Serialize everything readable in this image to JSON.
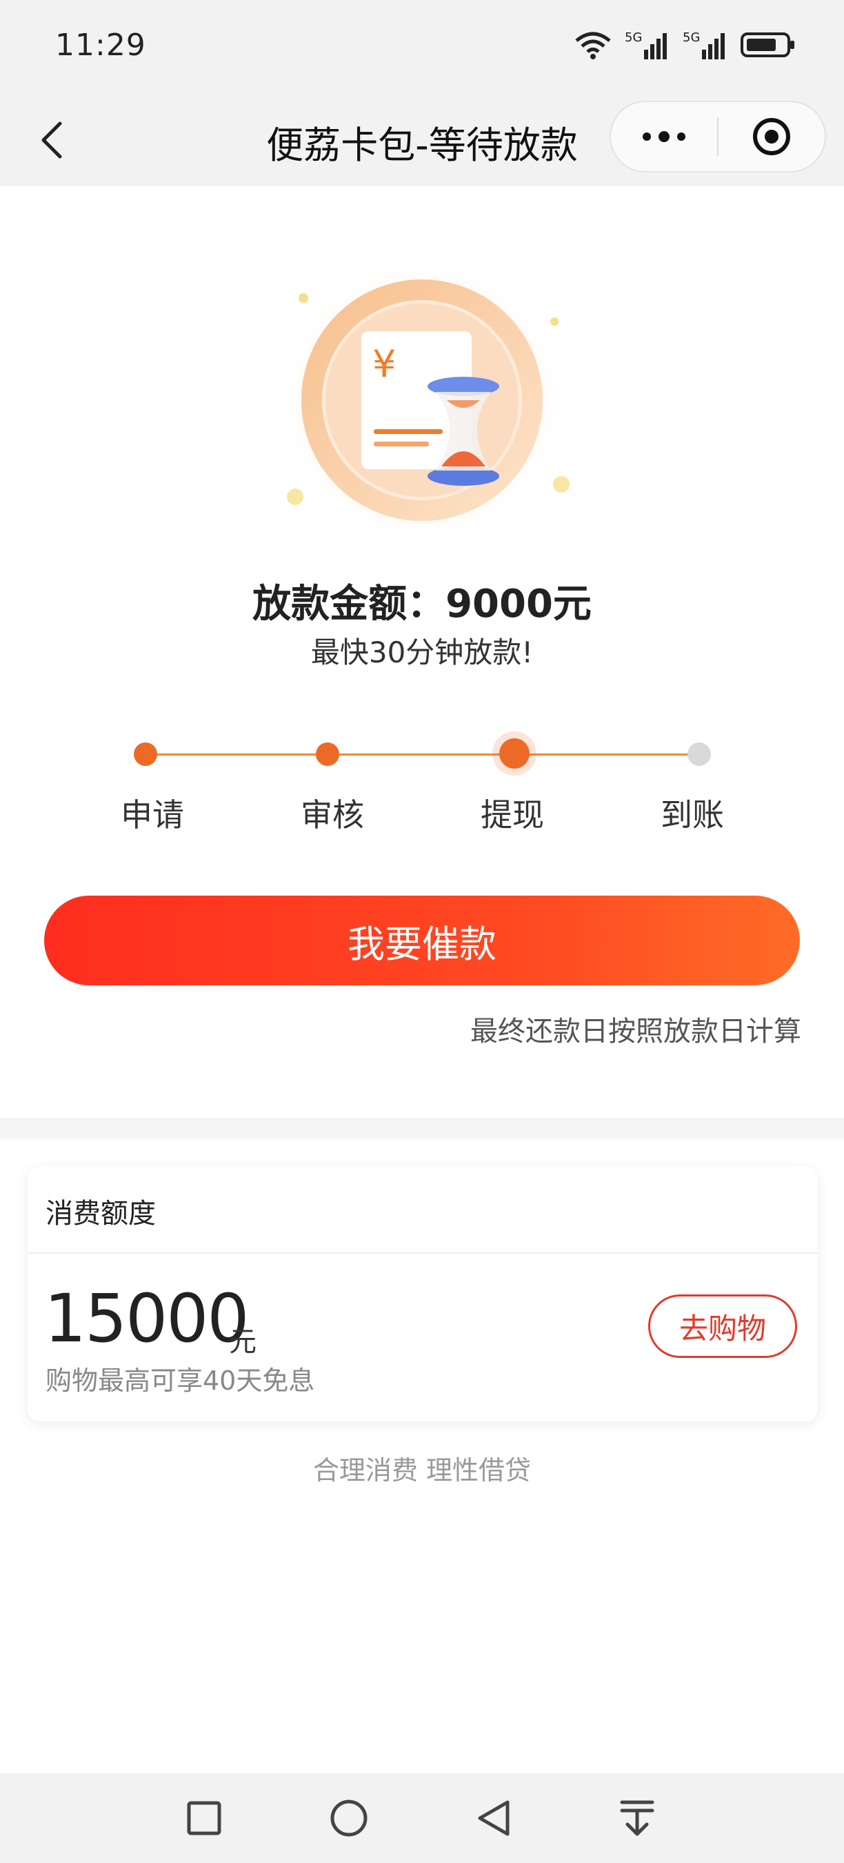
{
  "status_bar": {
    "time": "11:29"
  },
  "nav": {
    "title": "便荔卡包-等待放款"
  },
  "loan": {
    "amount_label": "放款金额：9000元",
    "subtitle": "最快30分钟放款!"
  },
  "steps": [
    {
      "label": "申请",
      "state": "done"
    },
    {
      "label": "审核",
      "state": "done"
    },
    {
      "label": "提现",
      "state": "current"
    },
    {
      "label": "到账",
      "state": "pending"
    }
  ],
  "actions": {
    "urge_label": "我要催款",
    "repay_note": "最终还款日按照放款日计算"
  },
  "credit": {
    "title": "消费额度",
    "amount": "15000",
    "unit": "元",
    "note": "购物最高可享40天免息",
    "shop_label": "去购物"
  },
  "footer": {
    "tip": "合理消费 理性借贷"
  },
  "colors": {
    "accent": "#ec6a26",
    "button_start": "#ff2d1f",
    "button_end": "#ff6c27",
    "shop_border": "#e23a2b"
  }
}
